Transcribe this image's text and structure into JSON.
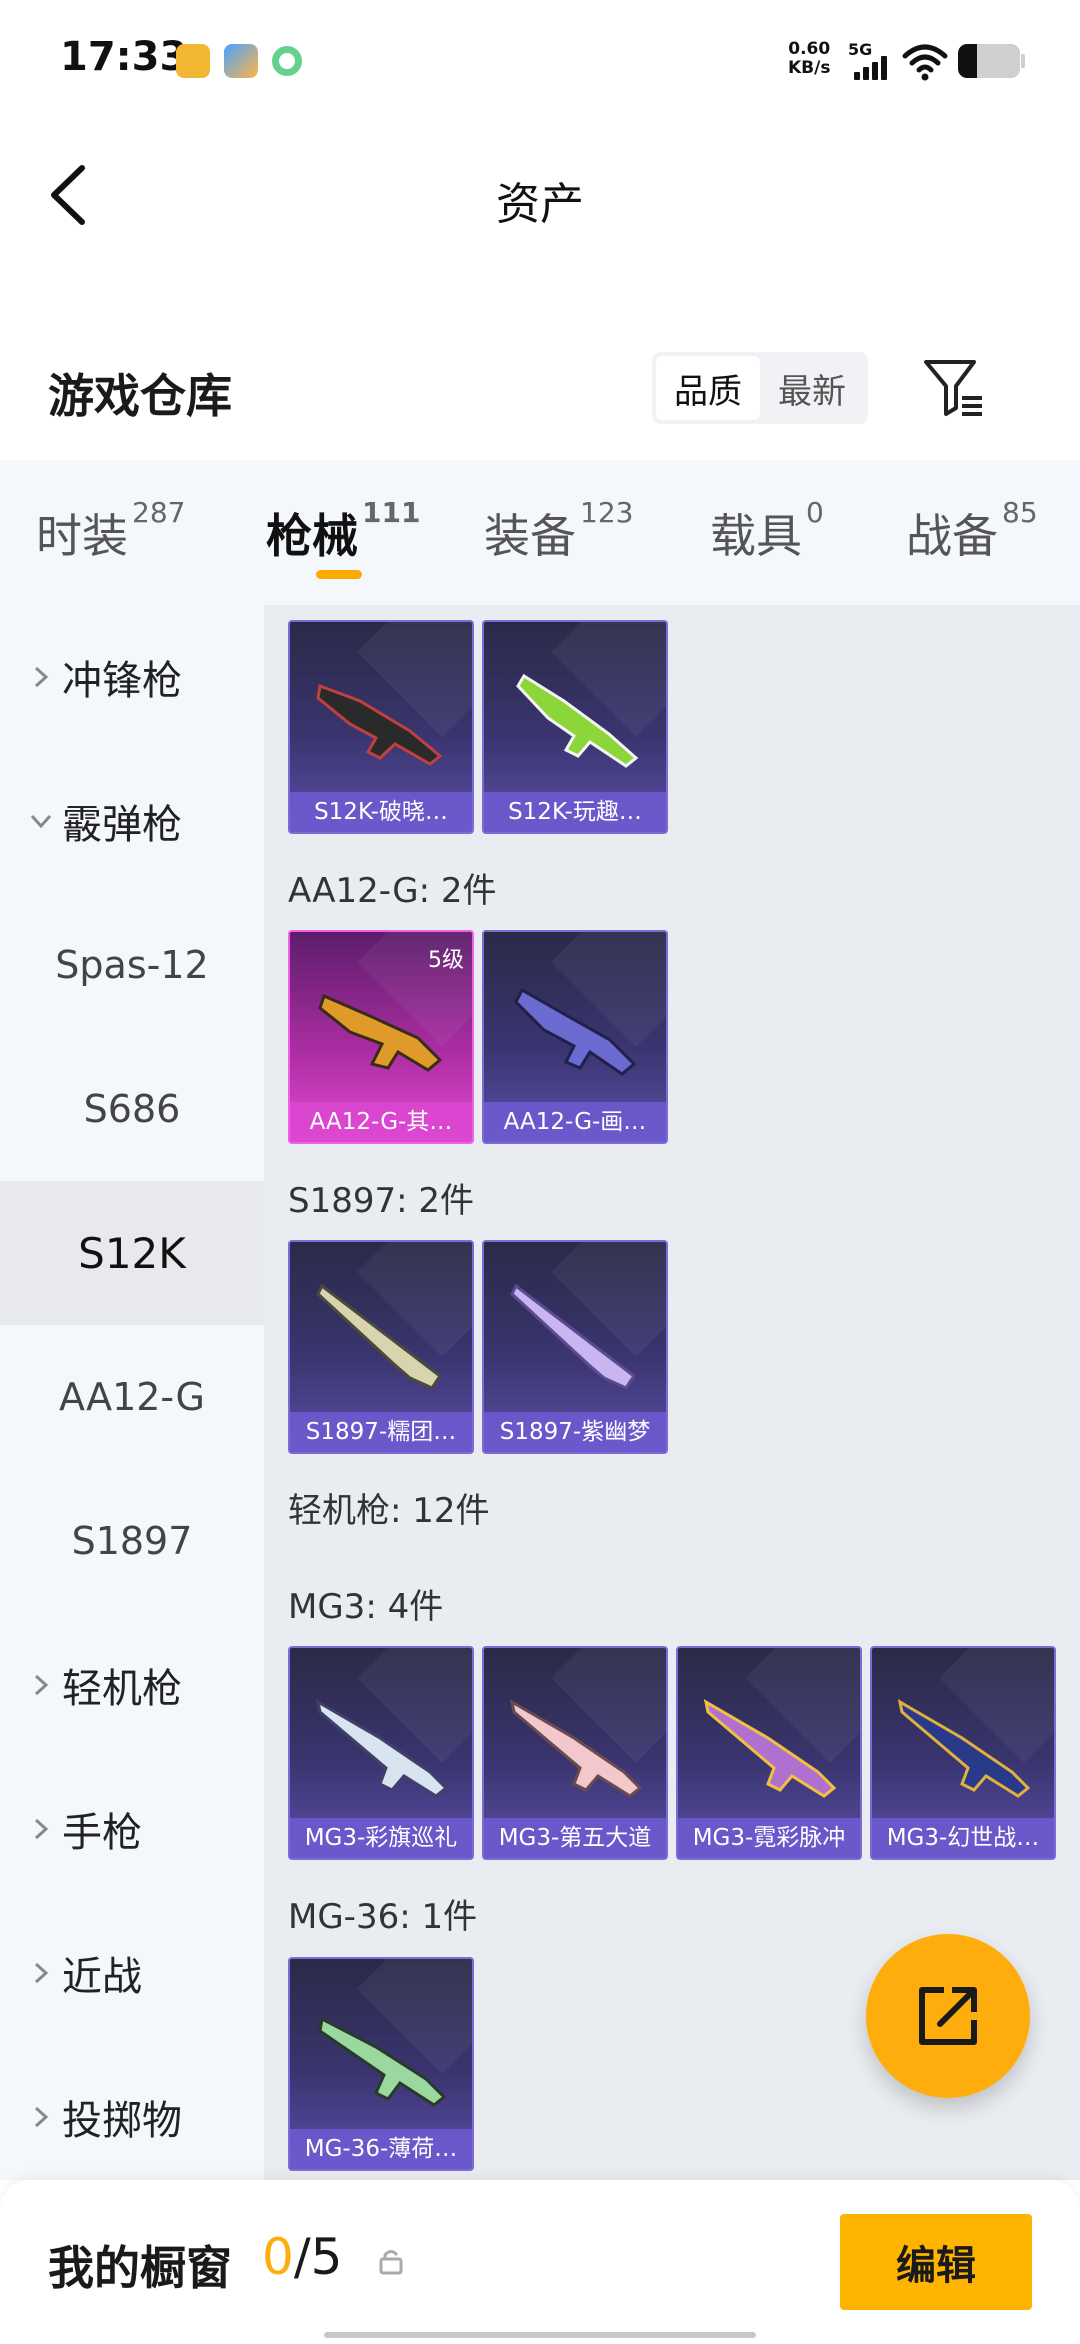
{
  "status_bar": {
    "time": "17:33",
    "net_speed_value": "0.60",
    "net_speed_unit": "KB/s",
    "network_type": "5G",
    "battery_level": 0.3
  },
  "header": {
    "title": "资产",
    "back_icon": "chevron-left-icon"
  },
  "warehouse": {
    "title": "游戏仓库",
    "sort_options": [
      "品质",
      "最新"
    ],
    "sort_selected": "品质",
    "filter_icon": "filter-icon"
  },
  "tabs": [
    {
      "label": "时装",
      "count": "287"
    },
    {
      "label": "枪械",
      "count": "111",
      "active": true
    },
    {
      "label": "装备",
      "count": "123"
    },
    {
      "label": "载具",
      "count": "0"
    },
    {
      "label": "战备",
      "count": "85"
    }
  ],
  "sidebar": {
    "items": [
      {
        "label": "冲锋枪",
        "kind": "category",
        "expanded": false
      },
      {
        "label": "霰弹枪",
        "kind": "category",
        "expanded": true
      },
      {
        "label": "Spas-12",
        "kind": "sub"
      },
      {
        "label": "S686",
        "kind": "sub"
      },
      {
        "label": "S12K",
        "kind": "sub",
        "selected": true
      },
      {
        "label": "AA12-G",
        "kind": "sub"
      },
      {
        "label": "S1897",
        "kind": "sub"
      },
      {
        "label": "轻机枪",
        "kind": "category",
        "expanded": false
      },
      {
        "label": "手枪",
        "kind": "category",
        "expanded": false
      },
      {
        "label": "近战",
        "kind": "category",
        "expanded": false
      },
      {
        "label": "投掷物",
        "kind": "category",
        "expanded": false
      }
    ]
  },
  "content": {
    "groups": [
      {
        "label": "",
        "items": [
          {
            "name": "S12K-破晓…",
            "style": "purple"
          },
          {
            "name": "S12K-玩趣…",
            "style": "purple"
          }
        ]
      },
      {
        "label": "AA12-G: 2件",
        "items": [
          {
            "name": "AA12-G-其…",
            "style": "pink",
            "level": "5级"
          },
          {
            "name": "AA12-G-画…",
            "style": "purple"
          }
        ]
      },
      {
        "label": "S1897: 2件",
        "items": [
          {
            "name": "S1897-糯团…",
            "style": "purple"
          },
          {
            "name": "S1897-紫幽梦",
            "style": "purple"
          }
        ]
      },
      {
        "label": "轻机枪: 12件",
        "items": []
      },
      {
        "label": "MG3: 4件",
        "items": [
          {
            "name": "MG3-彩旗巡礼",
            "style": "purple"
          },
          {
            "name": "MG3-第五大道",
            "style": "purple"
          },
          {
            "name": "MG3-霓彩脉冲",
            "style": "purple"
          },
          {
            "name": "MG3-幻世战…",
            "style": "purple"
          }
        ]
      },
      {
        "label": "MG-36: 1件",
        "items": [
          {
            "name": "MG-36-薄荷…",
            "style": "purple"
          }
        ]
      }
    ]
  },
  "fab": {
    "icon": "share-external-icon"
  },
  "bottom_bar": {
    "label": "我的橱窗",
    "count_current": "0",
    "count_separator": "/",
    "count_total": "5",
    "lock_icon": "lock-icon",
    "edit_label": "编辑"
  },
  "colors": {
    "accent": "#ffad0d",
    "tab_indicator": "#ffa800",
    "card_purple": "#5c4ea8",
    "card_pink": "#e04fd0"
  }
}
